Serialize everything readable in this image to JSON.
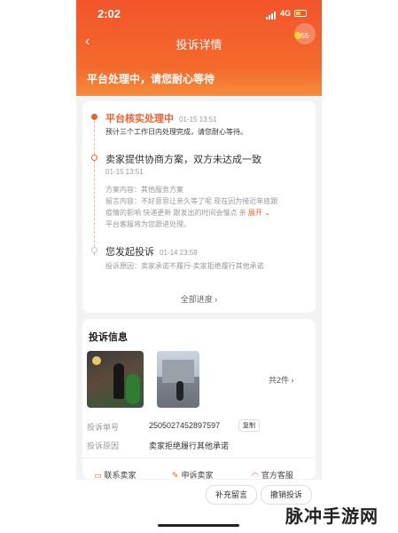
{
  "status_bar": {
    "time": "2:02",
    "network": "4G"
  },
  "nav": {
    "title": "投诉详情",
    "service_badge": "55"
  },
  "banner": {
    "text": "平台处理中，请您耐心等待"
  },
  "progress": {
    "steps": [
      {
        "title": "平台核实处理中",
        "time": "01-15 13:51",
        "desc": "预计三个工作日内处理完成，请您耐心等待。"
      },
      {
        "title": "卖家提供协商方案，双方未达成一致",
        "time": "01-15 13:51",
        "lines": [
          "方案内容：其他服务方案",
          "留言内容：不好意思让亲久等了呢 现在因为接近年底跟",
          "疫情的影响 快递更新 跟发出的时间会慢点  亲",
          "平台客服将为您跟进处理。"
        ],
        "expand_label": "展开"
      },
      {
        "title": "您发起投诉",
        "time": "01-14 23:59",
        "reason_line": "投诉原因：卖家承诺不履行-卖家拒绝履行其他承诺"
      }
    ],
    "all_progress_label": "全部进度 ›"
  },
  "complaint_info": {
    "title": "投诉信息",
    "photo_count_label": "共2件 ›",
    "number_label": "投诉单号",
    "number_value": "2505027452897597",
    "copy_label": "复制",
    "reason_label": "投诉原因",
    "reason_value": "卖家拒绝履行其他承诺"
  },
  "actions": {
    "contact_seller": "联系卖家",
    "appeal_seller": "申诉卖家",
    "official_service": "官方客服"
  },
  "bottom_bar": {
    "add_message": "补充留言",
    "cancel_complaint": "撤销投诉"
  },
  "watermark": "脉冲手游网",
  "colors": {
    "accent": "#f0602e",
    "header_top": "#f2542a"
  }
}
